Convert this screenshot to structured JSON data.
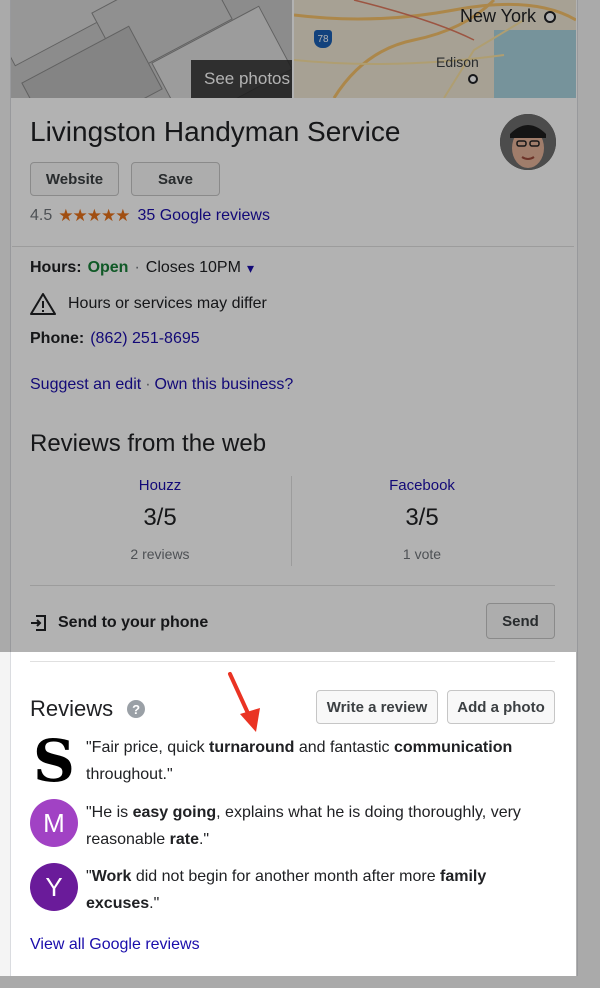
{
  "header": {
    "see_photos_label": "See photos",
    "map_labels": {
      "city": "New York",
      "town": "Edison",
      "highway": "78"
    }
  },
  "business": {
    "name": "Livingston Handyman Service",
    "buttons": {
      "website": "Website",
      "save": "Save"
    },
    "rating": "4.5",
    "stars": "★★★★★",
    "reviews_link": "35 Google reviews"
  },
  "info": {
    "hours_label": "Hours:",
    "hours_status": "Open",
    "hours_separator": "·",
    "hours_close": "Closes 10PM",
    "hours_dropdown": "▾",
    "warning": "Hours or services may differ",
    "phone_label": "Phone:",
    "phone_value": "(862) 251-8695",
    "suggest_edit": "Suggest an edit",
    "link_separator": "·",
    "own_business": "Own this business?"
  },
  "web_reviews": {
    "title": "Reviews from the web",
    "sources": [
      {
        "name": "Houzz",
        "score": "3/5",
        "count": "2 reviews"
      },
      {
        "name": "Facebook",
        "score": "3/5",
        "count": "1 vote"
      }
    ]
  },
  "send": {
    "label": "Send to your phone",
    "button": "Send"
  },
  "reviews": {
    "title": "Reviews",
    "help_icon": "?",
    "write_review": "Write a review",
    "add_photo": "Add a photo",
    "items": [
      {
        "avatar": "S",
        "avatar_color": "#000000",
        "p1": "\"Fair price, quick ",
        "b1": "turnaround",
        "p2": " and fantastic ",
        "b2": "communication",
        "p3": " throughout.\""
      },
      {
        "avatar": "M",
        "avatar_color": "#a142c4",
        "p1": "\"He is ",
        "b1": "easy going",
        "p2": ", explains what he is doing thoroughly, very reasonable ",
        "b2": "rate",
        "p3": ".\""
      },
      {
        "avatar": "Y",
        "avatar_color": "#6a1b9a",
        "p1": "\"",
        "b1": "Work",
        "p2": " did not begin for another month after more ",
        "b2": "family",
        "p3": " ",
        "b3": "excuses",
        "p4": ".\""
      }
    ],
    "view_all": "View all Google reviews"
  },
  "colors": {
    "link": "#1a0dab",
    "open": "#188038",
    "star": "#e7711b",
    "annotation_arrow": "#ea3323"
  }
}
